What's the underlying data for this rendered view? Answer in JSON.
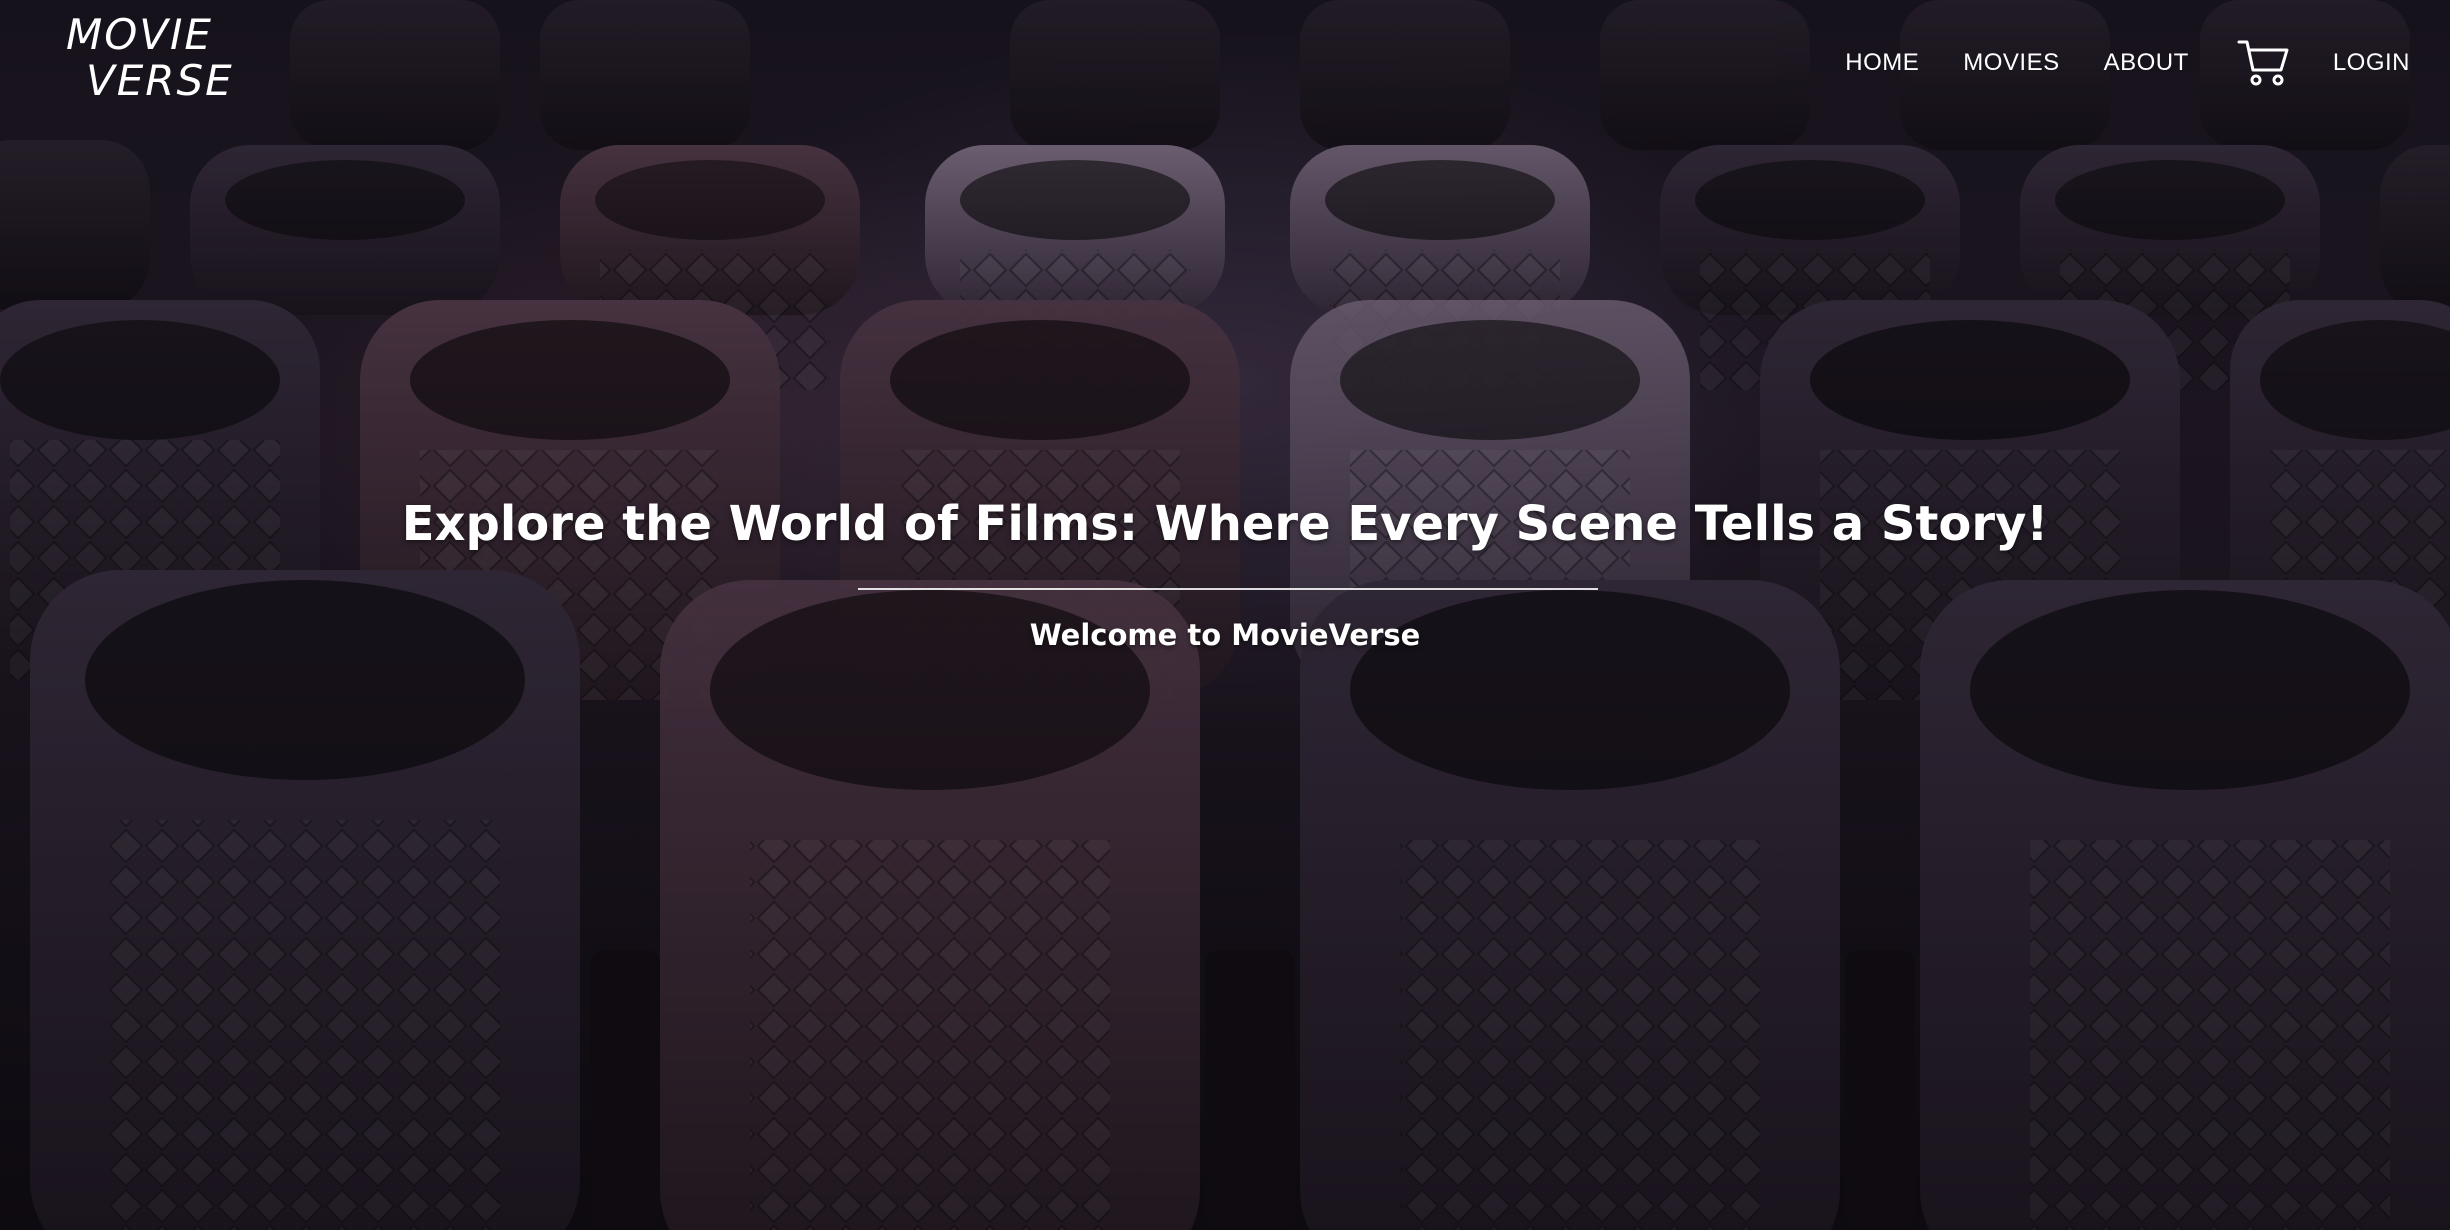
{
  "logo": {
    "line1": "MOVIE",
    "line2": "VERSE"
  },
  "nav": {
    "items": [
      {
        "label": "HOME"
      },
      {
        "label": "MOVIES"
      },
      {
        "label": "ABOUT"
      }
    ],
    "cart_icon": "shopping-cart-icon",
    "login_label": "LOGIN"
  },
  "hero": {
    "background": "cinema-seats-photo",
    "headline": "Explore the World of Films: Where Every Scene Tells a Story!",
    "subheadline": "Welcome to MovieVerse"
  },
  "colors": {
    "text": "#ffffff",
    "background": "#1a1620"
  }
}
